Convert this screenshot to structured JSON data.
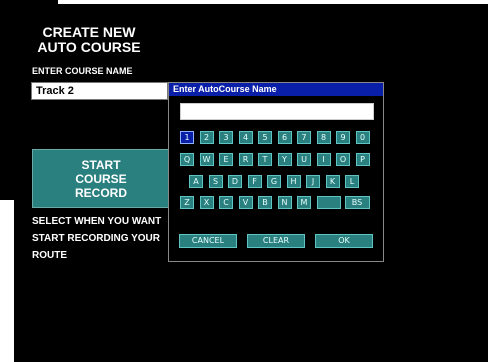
{
  "screen": {
    "title_line1": "CREATE NEW",
    "title_line2": "AUTO COURSE",
    "course_name_label": "ENTER COURSE NAME",
    "course_name_value": "Track 2",
    "start_button": {
      "line1": "START",
      "line2": "COURSE",
      "line3": "RECORD"
    },
    "help_line1": "SELECT WHEN YOU WANT",
    "help_line2": "START RECORDING YOUR",
    "help_line3": "ROUTE"
  },
  "dialog": {
    "title": "Enter AutoCourse Name",
    "input_value": "",
    "rows": [
      [
        "1",
        "2",
        "3",
        "4",
        "5",
        "6",
        "7",
        "8",
        "9",
        "0"
      ],
      [
        "Q",
        "W",
        "E",
        "R",
        "T",
        "Y",
        "U",
        "I",
        "O",
        "P"
      ],
      [
        "A",
        "S",
        "D",
        "F",
        "G",
        "H",
        "J",
        "K",
        "L"
      ],
      [
        "Z",
        "X",
        "C",
        "V",
        "B",
        "N",
        "M",
        "",
        "BS"
      ]
    ],
    "selected_key": "1",
    "cancel_label": "CANCEL",
    "clear_label": "CLEAR",
    "ok_label": "OK"
  },
  "colors": {
    "background": "#000000",
    "key_fill": "#2a7f7f",
    "key_border": "#5fc4c4",
    "title_bar": "#0a1fa8",
    "selected_key": "#0a1fa8"
  }
}
